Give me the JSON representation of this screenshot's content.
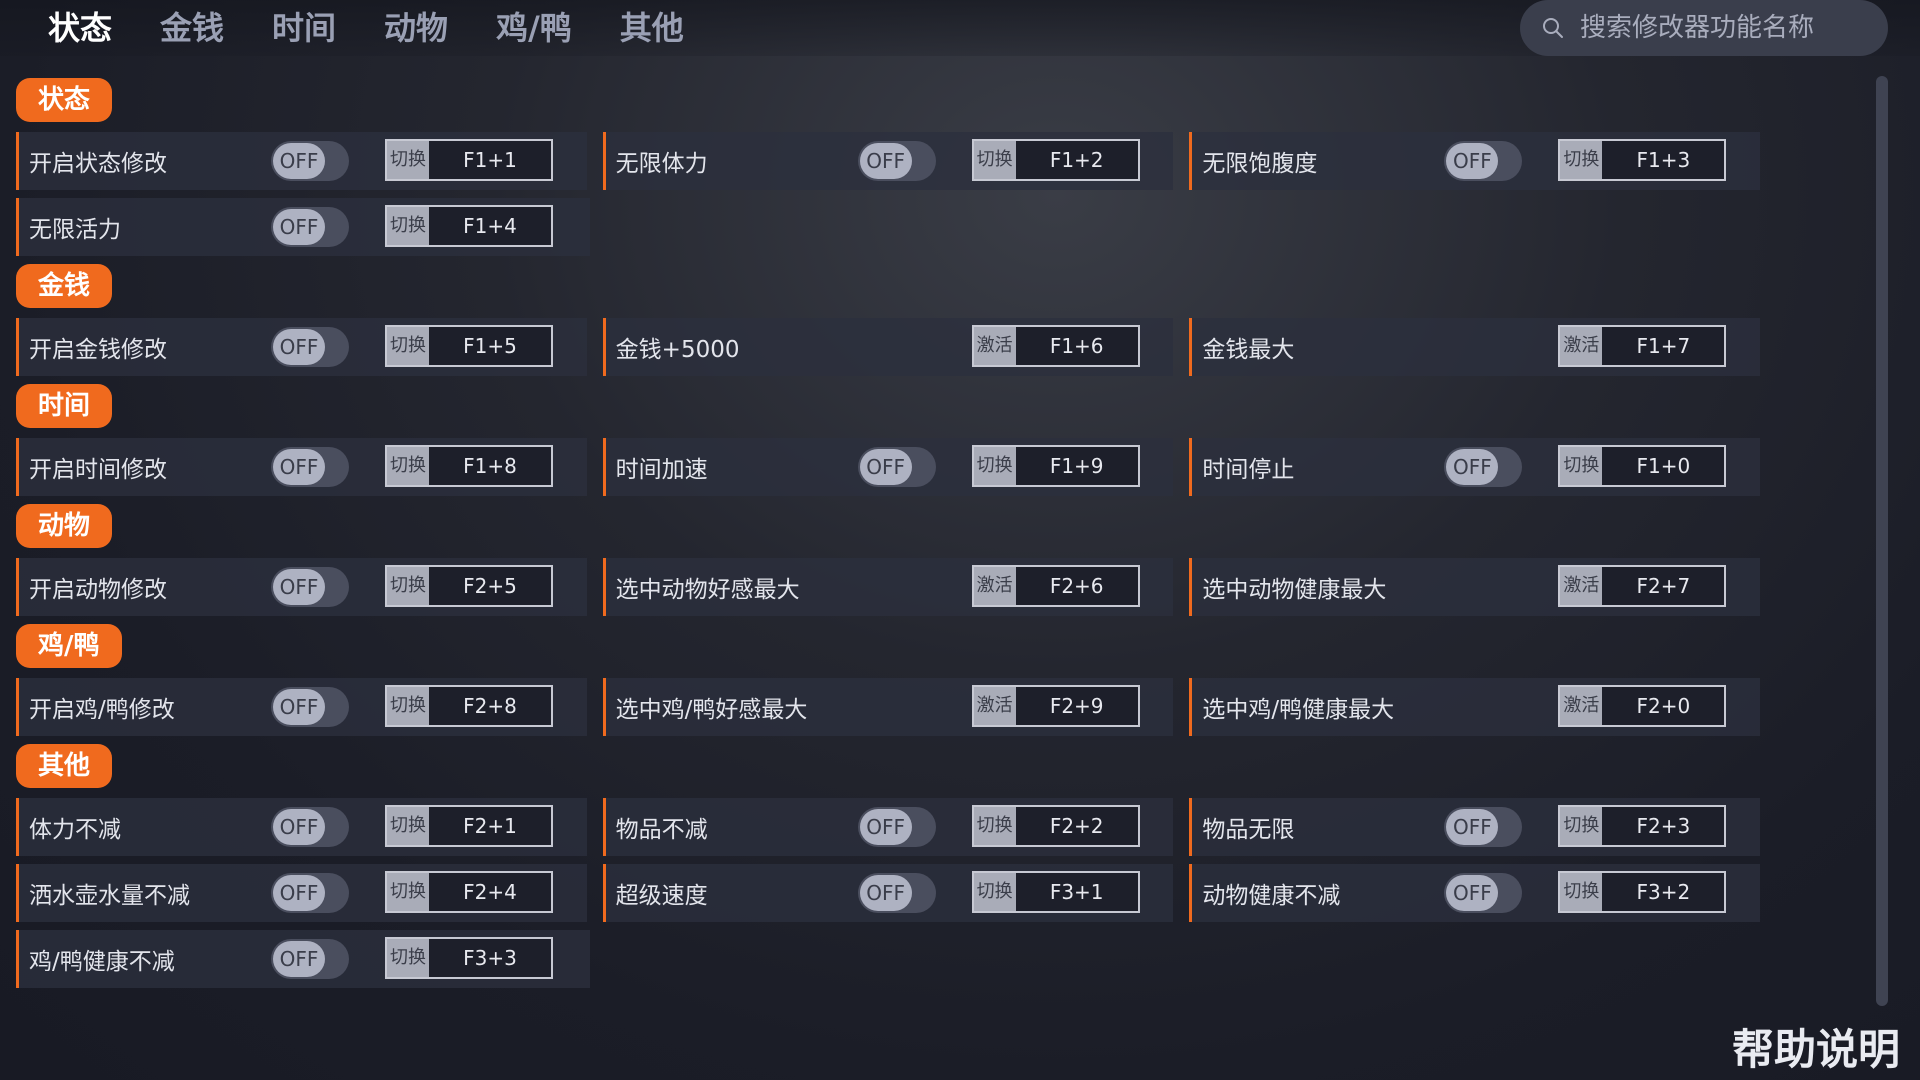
{
  "nav": {
    "tabs": [
      "状态",
      "金钱",
      "时间",
      "动物",
      "鸡/鸭",
      "其他"
    ],
    "active_tab": "状态",
    "search_placeholder": "搜索修改器功能名称"
  },
  "toggle_state": "OFF",
  "sections": [
    {
      "title": "状态",
      "rows": [
        [
          {
            "label": "开启状态修改",
            "toggle": true,
            "action": "切换",
            "key": "F1+1"
          },
          {
            "label": "无限体力",
            "toggle": true,
            "action": "切换",
            "key": "F1+2"
          },
          {
            "label": "无限饱腹度",
            "toggle": true,
            "action": "切换",
            "key": "F1+3"
          }
        ],
        [
          {
            "label": "无限活力",
            "toggle": true,
            "action": "切换",
            "key": "F1+4"
          }
        ]
      ]
    },
    {
      "title": "金钱",
      "rows": [
        [
          {
            "label": "开启金钱修改",
            "toggle": true,
            "action": "切换",
            "key": "F1+5"
          },
          {
            "label": "金钱+5000",
            "toggle": false,
            "action": "激活",
            "key": "F1+6"
          },
          {
            "label": "金钱最大",
            "toggle": false,
            "action": "激活",
            "key": "F1+7"
          }
        ]
      ]
    },
    {
      "title": "时间",
      "rows": [
        [
          {
            "label": "开启时间修改",
            "toggle": true,
            "action": "切换",
            "key": "F1+8"
          },
          {
            "label": "时间加速",
            "toggle": true,
            "action": "切换",
            "key": "F1+9"
          },
          {
            "label": "时间停止",
            "toggle": true,
            "action": "切换",
            "key": "F1+0"
          }
        ]
      ]
    },
    {
      "title": "动物",
      "rows": [
        [
          {
            "label": "开启动物修改",
            "toggle": true,
            "action": "切换",
            "key": "F2+5"
          },
          {
            "label": "选中动物好感最大",
            "toggle": false,
            "action": "激活",
            "key": "F2+6"
          },
          {
            "label": "选中动物健康最大",
            "toggle": false,
            "action": "激活",
            "key": "F2+7"
          }
        ]
      ]
    },
    {
      "title": "鸡/鸭",
      "rows": [
        [
          {
            "label": "开启鸡/鸭修改",
            "toggle": true,
            "action": "切换",
            "key": "F2+8"
          },
          {
            "label": "选中鸡/鸭好感最大",
            "toggle": false,
            "action": "激活",
            "key": "F2+9"
          },
          {
            "label": "选中鸡/鸭健康最大",
            "toggle": false,
            "action": "激活",
            "key": "F2+0"
          }
        ]
      ]
    },
    {
      "title": "其他",
      "rows": [
        [
          {
            "label": "体力不减",
            "toggle": true,
            "action": "切换",
            "key": "F2+1"
          },
          {
            "label": "物品不减",
            "toggle": true,
            "action": "切换",
            "key": "F2+2"
          },
          {
            "label": "物品无限",
            "toggle": true,
            "action": "切换",
            "key": "F2+3"
          }
        ],
        [
          {
            "label": "洒水壶水量不减",
            "toggle": true,
            "action": "切换",
            "key": "F2+4"
          },
          {
            "label": "超级速度",
            "toggle": true,
            "action": "切换",
            "key": "F3+1"
          },
          {
            "label": "动物健康不减",
            "toggle": true,
            "action": "切换",
            "key": "F3+2"
          }
        ],
        [
          {
            "label": "鸡/鸭健康不减",
            "toggle": true,
            "action": "切换",
            "key": "F3+3"
          }
        ]
      ]
    }
  ],
  "help_label": "帮助说明",
  "colors": {
    "accent": "#f06a1e",
    "background": "#1b1d27",
    "cell": "#2c2f3e"
  }
}
